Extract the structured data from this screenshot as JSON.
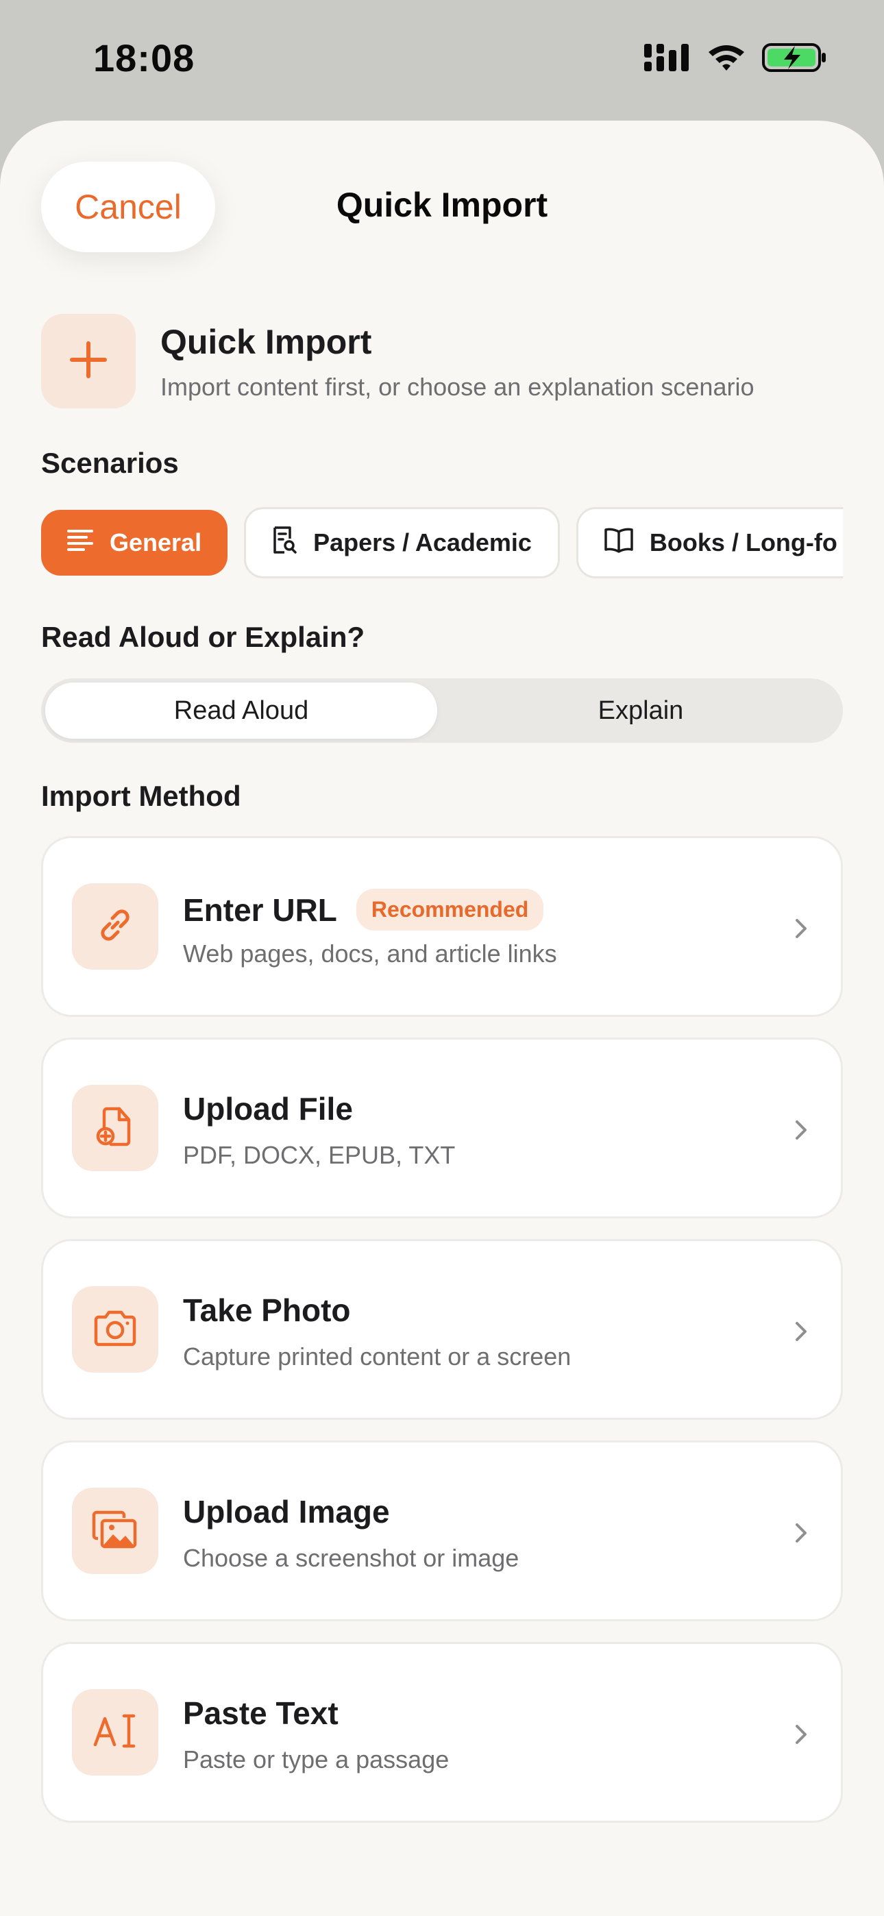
{
  "status_bar": {
    "time": "18:08",
    "icons": [
      "signal-icon",
      "wifi-icon",
      "battery-charging-icon"
    ],
    "battery_color": "#4cd964"
  },
  "nav": {
    "cancel_label": "Cancel",
    "title": "Quick Import"
  },
  "hero": {
    "icon": "plus-icon",
    "title": "Quick Import",
    "subtitle": "Import content first, or choose an explanation scenario"
  },
  "scenarios": {
    "label": "Scenarios",
    "items": [
      {
        "label": "General",
        "icon": "lines-icon",
        "selected": true
      },
      {
        "label": "Papers / Academic",
        "icon": "document-search-icon",
        "selected": false
      },
      {
        "label": "Books / Long-fo",
        "icon": "book-icon",
        "selected": false
      }
    ]
  },
  "mode": {
    "label": "Read Aloud or Explain?",
    "options": [
      "Read Aloud",
      "Explain"
    ],
    "selected": "Read Aloud"
  },
  "import_method": {
    "label": "Import Method",
    "items": [
      {
        "title": "Enter URL",
        "badge": "Recommended",
        "subtitle": "Web pages, docs, and article links",
        "icon": "link-icon"
      },
      {
        "title": "Upload File",
        "subtitle": "PDF, DOCX, EPUB, TXT",
        "icon": "file-add-icon"
      },
      {
        "title": "Take Photo",
        "subtitle": "Capture printed content or a screen",
        "icon": "camera-icon"
      },
      {
        "title": "Upload Image",
        "subtitle": "Choose a screenshot or image",
        "icon": "images-icon"
      },
      {
        "title": "Paste Text",
        "subtitle": "Paste or type a passage",
        "icon": "text-cursor-icon"
      }
    ]
  },
  "colors": {
    "accent": "#ed6c2d",
    "accent_soft": "#f9e7dc",
    "sheet_bg": "#f8f7f3"
  }
}
